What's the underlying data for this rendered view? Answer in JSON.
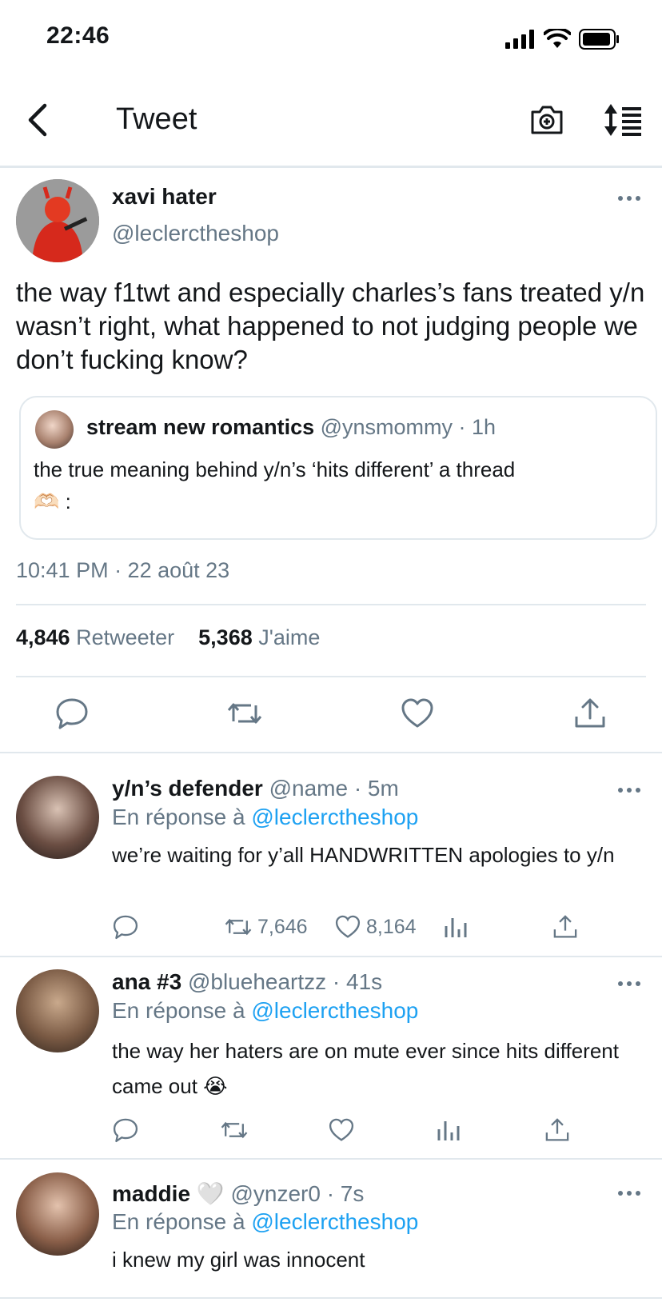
{
  "status_bar": {
    "time": "22:46"
  },
  "nav": {
    "title": "Tweet"
  },
  "tweet": {
    "display_name": "xavi hater",
    "handle": "@leclerctheshop",
    "text": "the way f1twt and especially charles’s fans treated y/n wasn’t right, what happened to not judging people we don’t fucking know?",
    "quote": {
      "display_name": "stream new romantics",
      "meta": "@ynsmommy · 1h",
      "text": "the true meaning behind y/n’s ‘hits different’ a thread",
      "emoji": "🫶🏻 :"
    },
    "timestamp": "10:41 PM · 22 août 23",
    "retweets_count": "4,846",
    "retweets_label": "Retweeter",
    "likes_count": "5,368",
    "likes_label": "J'aime"
  },
  "replies": [
    {
      "display_name": "y/n’s defender",
      "meta": "@name · 5m",
      "in_reply_prefix": "En réponse à",
      "in_reply_handle": "@leclerctheshop",
      "text": "we’re waiting for y’all HANDWRITTEN apologies to y/n",
      "retweets": "7,646",
      "likes": "8,164"
    },
    {
      "display_name": "ana #3",
      "meta": "@blueheartzz · 41s",
      "in_reply_prefix": "En réponse à",
      "in_reply_handle": "@leclerctheshop",
      "text": "the way her haters are on mute ever since hits different came out 😭",
      "retweets": "",
      "likes": ""
    },
    {
      "display_name": "maddie 🤍",
      "meta": "@ynzer0 · 7s",
      "in_reply_prefix": "En réponse à",
      "in_reply_handle": "@leclerctheshop",
      "text": "i knew my girl was innocent"
    }
  ],
  "colors": {
    "accent": "#1da1f2",
    "secondary_text": "#657786",
    "divider": "#e1e8ed"
  },
  "icons": [
    "back-chevron-icon",
    "camera-plus-icon",
    "sort-icon",
    "reply-icon",
    "retweet-icon",
    "like-icon",
    "share-icon",
    "analytics-icon",
    "more-icon"
  ]
}
